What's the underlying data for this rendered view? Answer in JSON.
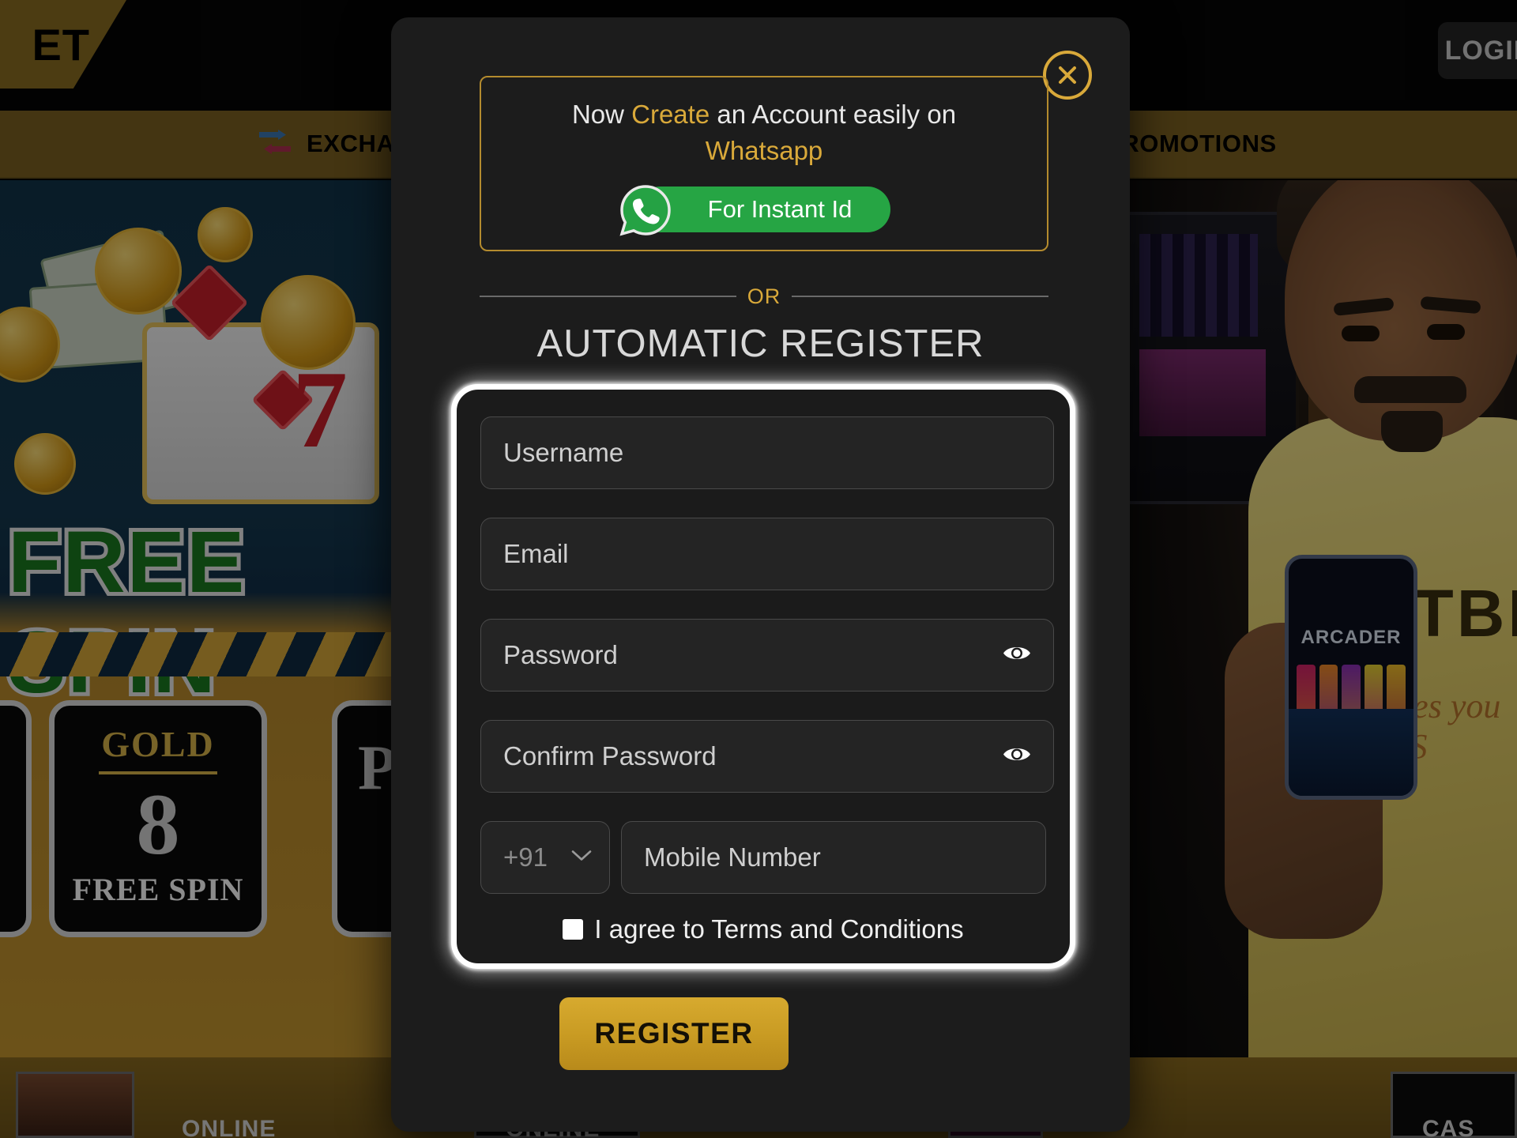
{
  "background": {
    "logo_text": "ET",
    "login_button": "LOGIN",
    "nav": [
      {
        "label": "EXCHANGE",
        "icon": "exchange-arrows-icon"
      },
      {
        "label": "PROMOTIONS",
        "icon": ""
      }
    ],
    "left_promo": {
      "headline": "FREE SPIN",
      "seven": "7",
      "card_title": "GOLD",
      "card_number": "8",
      "card_subtitle": "FREE SPIN",
      "side_card_letter": "P"
    },
    "right_promo": {
      "phone_game_title": "ARCADER",
      "shirt_text": "ATBE",
      "shirt_script": "Makes you feel S"
    },
    "footer": {
      "labels": [
        "ONLINE",
        "ONLINE",
        "CAS"
      ]
    }
  },
  "modal": {
    "close_icon": "close-circle-icon",
    "whatsapp_promo": {
      "line1_pre": "Now ",
      "line1_highlight": "Create",
      "line1_post": " an Account easily on",
      "line2": "Whatsapp",
      "button_label": "For Instant Id",
      "button_icon": "whatsapp-icon"
    },
    "divider_text": "OR",
    "title": "AUTOMATIC REGISTER",
    "form": {
      "username": {
        "placeholder": "Username",
        "value": ""
      },
      "email": {
        "placeholder": "Email",
        "value": ""
      },
      "password": {
        "placeholder": "Password",
        "value": "",
        "toggle_icon": "eye-icon"
      },
      "confirm_password": {
        "placeholder": "Confirm Password",
        "value": "",
        "toggle_icon": "eye-icon"
      },
      "country_code": {
        "selected": "+91",
        "chevron_icon": "chevron-down-icon"
      },
      "mobile": {
        "placeholder": "Mobile Number",
        "value": ""
      },
      "terms_label": "I agree to Terms and Conditions",
      "terms_checked": false
    },
    "submit_label": "REGISTER"
  },
  "colors": {
    "gold": "#d9a93a",
    "whatsapp_green": "#26a544",
    "modal_bg": "#1c1c1c",
    "field_bg": "#242424",
    "nav_gold": "#7d6222"
  }
}
